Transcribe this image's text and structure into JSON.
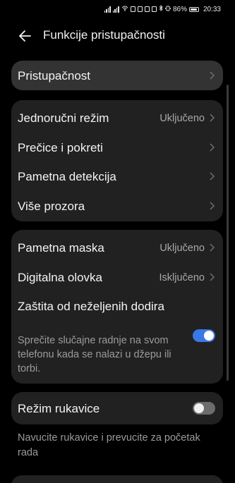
{
  "status_bar": {
    "battery_percent": "86%",
    "time": "20:33"
  },
  "header": {
    "title": "Funkcije pristupačnosti",
    "back_icon": "arrow-left-icon"
  },
  "cards": {
    "accessibility": {
      "label": "Pristupačnost"
    },
    "group1": {
      "one_hand": {
        "label": "Jednoručni režim",
        "value": "Uključeno"
      },
      "shortcuts": {
        "label": "Prečice i pokreti"
      },
      "smart_detect": {
        "label": "Pametna detekcija"
      },
      "multi_window": {
        "label": "Više prozora"
      }
    },
    "group2": {
      "smart_mask": {
        "label": "Pametna maska",
        "value": "Uključeno"
      },
      "digital_pen": {
        "label": "Digitalna olovka",
        "value": "Isključeno"
      },
      "accidental_touch": {
        "label": "Zaštita od neželjenih dodira",
        "description": "Sprečite slučajne radnje na svom telefonu kada se nalazi u džepu ili torbi.",
        "enabled": true
      }
    },
    "glove_mode": {
      "label": "Režim rukavice",
      "enabled": false,
      "description": "Navucite rukavice i prevucite za početak rada"
    }
  },
  "colors": {
    "background": "#000000",
    "card": "#212121",
    "accent": "#3a78e6"
  }
}
